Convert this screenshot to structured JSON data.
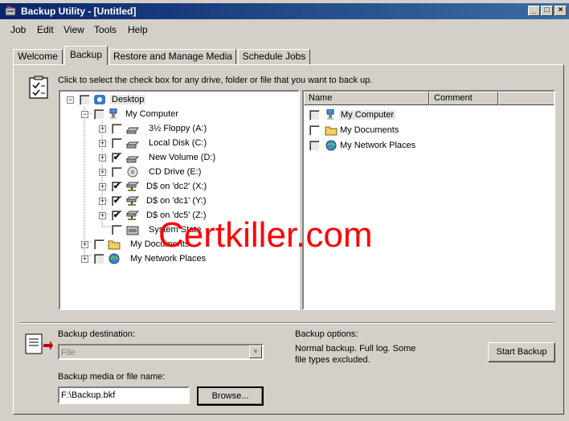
{
  "window": {
    "title": "Backup Utility - [Untitled]",
    "controls": {
      "minimize": "_",
      "restore": "□",
      "close": "×"
    }
  },
  "menu": [
    {
      "label": "Job"
    },
    {
      "label": "Edit"
    },
    {
      "label": "View"
    },
    {
      "label": "Tools"
    },
    {
      "label": "Help"
    }
  ],
  "tabs": [
    {
      "label": "Welcome"
    },
    {
      "label": "Backup",
      "active": true
    },
    {
      "label": "Restore and Manage Media"
    },
    {
      "label": "Schedule Jobs"
    }
  ],
  "instruction": "Click to select the check box for any drive, folder or file that you want to back up.",
  "tree": [
    {
      "label": "Desktop",
      "icon": "desktop-icon",
      "expander": "−",
      "checked": false
    },
    {
      "label": "My Computer",
      "icon": "my-computer-icon",
      "expander": "−",
      "checked": false
    },
    {
      "label": "3½ Floppy (A:)",
      "icon": "floppy-drive-icon",
      "expander": "+",
      "checked": false
    },
    {
      "label": "Local Disk (C:)",
      "icon": "hard-drive-icon",
      "expander": "+",
      "checked": false
    },
    {
      "label": "New Volume (D:)",
      "icon": "hard-drive-icon",
      "expander": "+",
      "checked": true
    },
    {
      "label": "CD Drive (E:)",
      "icon": "cd-drive-icon",
      "expander": "+",
      "checked": false
    },
    {
      "label": "D$ on 'dc2' (X:)",
      "icon": "network-drive-icon",
      "expander": "+",
      "checked": true
    },
    {
      "label": "D$ on 'dc1' (Y:)",
      "icon": "network-drive-icon",
      "expander": "+",
      "checked": true
    },
    {
      "label": "D$ on 'dc5' (Z:)",
      "icon": "network-drive-icon",
      "expander": "+",
      "checked": true
    },
    {
      "label": "System State",
      "icon": "system-state-icon",
      "expander": "",
      "checked": false
    },
    {
      "label": "My Documents",
      "icon": "folder-icon",
      "expander": "+",
      "checked": false
    },
    {
      "label": "My Network Places",
      "icon": "network-places-icon",
      "expander": "+",
      "checked": false
    }
  ],
  "list": {
    "columns": [
      "Name",
      "Comment"
    ],
    "items": [
      {
        "name": "My Computer",
        "icon": "my-computer-icon",
        "selected": true
      },
      {
        "name": "My Documents",
        "icon": "folder-icon"
      },
      {
        "name": "My Network Places",
        "icon": "network-places-icon"
      }
    ]
  },
  "backup": {
    "destination_label": "Backup destination:",
    "destination_value": "File",
    "media_label": "Backup media or file name:",
    "media_value": "F:\\Backup.bkf",
    "browse_label": "Browse...",
    "options_label": "Backup options:",
    "options_text_1": "Normal backup.  Full log.  Some",
    "options_text_2": "file types excluded.",
    "start_label": "Start Backup"
  },
  "watermark": "Certkiller.com",
  "colors": {
    "title_start": "#0a246a",
    "title_end": "#3a6ea5",
    "face": "#d4d0c8",
    "watermark": "#ff0000"
  }
}
